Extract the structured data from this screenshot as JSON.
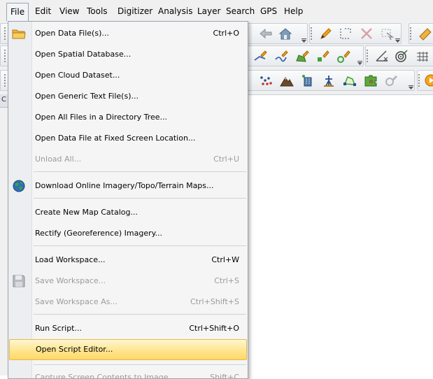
{
  "menubar": {
    "items": [
      {
        "label": "File",
        "active": true
      },
      {
        "label": "Edit"
      },
      {
        "label": "View"
      },
      {
        "label": "Tools"
      },
      {
        "label": "Digitizer"
      },
      {
        "label": "Analysis"
      },
      {
        "label": "Layer"
      },
      {
        "label": "Search"
      },
      {
        "label": "GPS"
      },
      {
        "label": "Help"
      }
    ]
  },
  "panel": {
    "fragment_label": "C"
  },
  "file_menu": {
    "items": [
      {
        "label": "Open Data File(s)...",
        "shortcut": "Ctrl+O",
        "icon": "folder-icon",
        "enabled": true
      },
      {
        "label": "Open Spatial Database...",
        "shortcut": "",
        "enabled": true
      },
      {
        "label": "Open Cloud Dataset...",
        "shortcut": "",
        "enabled": true
      },
      {
        "label": "Open Generic Text File(s)...",
        "shortcut": "",
        "enabled": true
      },
      {
        "label": "Open All Files in a Directory Tree...",
        "shortcut": "",
        "enabled": true
      },
      {
        "label": "Open Data File at Fixed Screen Location...",
        "shortcut": "",
        "enabled": true
      },
      {
        "label": "Unload All...",
        "shortcut": "Ctrl+U",
        "enabled": false
      },
      {
        "label": "Download Online Imagery/Topo/Terrain Maps...",
        "shortcut": "",
        "icon": "globe-icon",
        "enabled": true
      },
      {
        "label": "Create New Map Catalog...",
        "shortcut": "",
        "enabled": true
      },
      {
        "label": "Rectify (Georeference) Imagery...",
        "shortcut": "",
        "enabled": true
      },
      {
        "label": "Load Workspace...",
        "shortcut": "Ctrl+W",
        "enabled": true
      },
      {
        "label": "Save Workspace...",
        "shortcut": "Ctrl+S",
        "icon": "floppy-disk-icon",
        "enabled": false
      },
      {
        "label": "Save Workspace As...",
        "shortcut": "Ctrl+Shift+S",
        "enabled": false
      },
      {
        "label": "Run Script...",
        "shortcut": "Ctrl+Shift+O",
        "enabled": true
      },
      {
        "label": "Open Script Editor...",
        "shortcut": "",
        "enabled": true,
        "highlighted": true
      },
      {
        "label": "Capture Screen Contents to Image...",
        "shortcut": "Shift+C",
        "enabled": false
      }
    ]
  },
  "colors": {
    "highlight_top": "#fff6d2",
    "highlight_bottom": "#ffd968",
    "highlight_border": "#e5b84a",
    "disabled_text": "#9b9b9b",
    "menu_bg": "#f5f5f5"
  }
}
